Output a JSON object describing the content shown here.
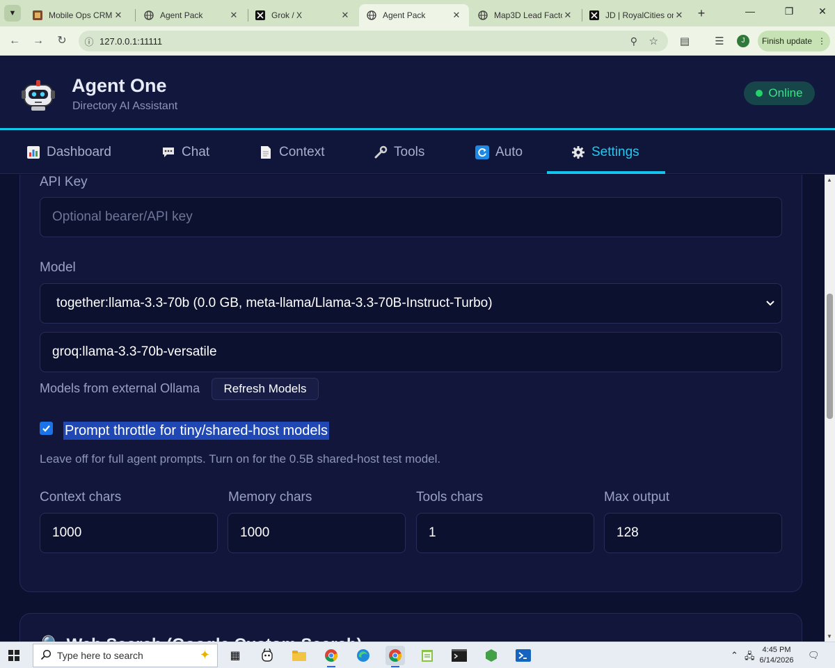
{
  "browser": {
    "tabs": [
      {
        "title": "Mobile Ops CRM - ",
        "icon": "crm-favicon-icon",
        "active": false
      },
      {
        "title": "Agent Pack",
        "icon": "globe-icon",
        "active": false
      },
      {
        "title": "Grok / X",
        "icon": "x-logo-icon",
        "active": false
      },
      {
        "title": "Agent Pack",
        "icon": "globe-icon",
        "active": true
      },
      {
        "title": "Map3D Lead Facto",
        "icon": "globe-icon",
        "active": false
      },
      {
        "title": "JD | RoyalCities on",
        "icon": "x-logo-icon",
        "active": false
      }
    ],
    "url": "127.0.0.1:11111",
    "profile_initial": "J",
    "finish_update_label": "Finish update"
  },
  "app": {
    "title": "Agent One",
    "subtitle": "Directory AI Assistant",
    "status": "Online",
    "status_color": "#22d36a",
    "accent_color": "#14c4ee"
  },
  "nav": {
    "tabs": [
      {
        "label": "Dashboard",
        "icon": "bar-chart-icon"
      },
      {
        "label": "Chat",
        "icon": "chat-bubble-icon"
      },
      {
        "label": "Context",
        "icon": "document-icon"
      },
      {
        "label": "Tools",
        "icon": "wrench-icon"
      },
      {
        "label": "Auto",
        "icon": "refresh-icon"
      },
      {
        "label": "Settings",
        "icon": "gear-icon",
        "active": true
      }
    ]
  },
  "settings": {
    "api_key_label": "API Key",
    "api_key_placeholder": "Optional bearer/API key",
    "model_label": "Model",
    "model_selected": "together:llama-3.3-70b (0.0 GB, meta-llama/Llama-3.3-70B-Instruct-Turbo)",
    "model_custom_value": "groq:llama-3.3-70b-versatile",
    "external_models_label": "Models from external Ollama",
    "refresh_models_label": "Refresh Models",
    "throttle_checked": true,
    "throttle_label": "Prompt throttle for tiny/shared-host models",
    "throttle_hint": "Leave off for full agent prompts. Turn on for the 0.5B shared-host test model.",
    "limits": [
      {
        "label": "Context chars",
        "value": "1000"
      },
      {
        "label": "Memory chars",
        "value": "1000"
      },
      {
        "label": "Tools chars",
        "value": "1"
      },
      {
        "label": "Max output",
        "value": "128"
      }
    ],
    "next_section_title": "Web Search (Google Custom Search)"
  },
  "taskbar": {
    "search_placeholder": "Type here to search",
    "time": "4:45 PM",
    "date": "6/14/2026"
  }
}
